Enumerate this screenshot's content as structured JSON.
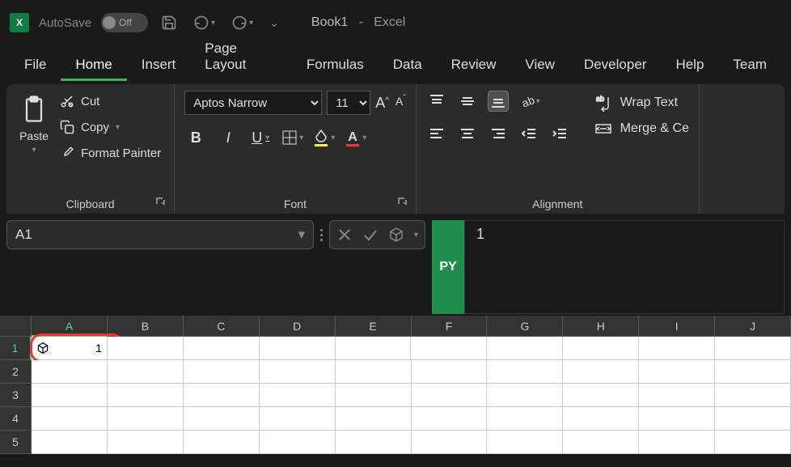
{
  "titleBar": {
    "autosaveLabel": "AutoSave",
    "autosaveState": "Off",
    "docName": "Book1",
    "dash": "-",
    "appName": "Excel"
  },
  "tabs": [
    "File",
    "Home",
    "Insert",
    "Page Layout",
    "Formulas",
    "Data",
    "Review",
    "View",
    "Developer",
    "Help",
    "Team"
  ],
  "activeTab": "Home",
  "ribbon": {
    "clipboard": {
      "pasteLabel": "Paste",
      "cutLabel": "Cut",
      "copyLabel": "Copy",
      "formatPainterLabel": "Format Painter",
      "groupLabel": "Clipboard"
    },
    "font": {
      "fontName": "Aptos Narrow",
      "fontSize": "11",
      "groupLabel": "Font"
    },
    "alignment": {
      "wrapLabel": "Wrap Text",
      "mergeLabel": "Merge & Ce",
      "groupLabel": "Alignment"
    }
  },
  "nameBox": "A1",
  "pyBadge": "PY",
  "formulaValue": "1",
  "grid": {
    "cols": [
      "A",
      "B",
      "C",
      "D",
      "E",
      "F",
      "G",
      "H",
      "I",
      "J"
    ],
    "rows": [
      "1",
      "2",
      "3",
      "4",
      "5"
    ],
    "a1Value": "1"
  }
}
